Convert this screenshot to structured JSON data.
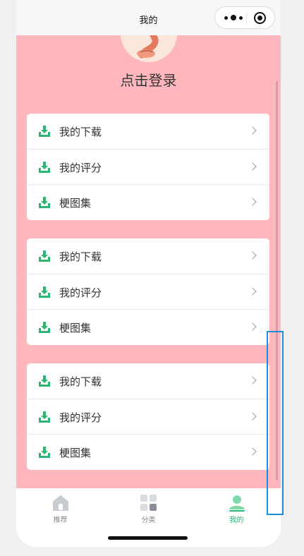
{
  "header": {
    "title": "我的"
  },
  "profile": {
    "login_text": "点击登录"
  },
  "menu_groups": [
    {
      "items": [
        {
          "label": "我的下载"
        },
        {
          "label": "我的评分"
        },
        {
          "label": "梗图集"
        }
      ]
    },
    {
      "items": [
        {
          "label": "我的下载"
        },
        {
          "label": "我的评分"
        },
        {
          "label": "梗图集"
        }
      ]
    },
    {
      "items": [
        {
          "label": "我的下载"
        },
        {
          "label": "我的评分"
        },
        {
          "label": "梗图集"
        }
      ]
    }
  ],
  "tabs": [
    {
      "label": "推荐",
      "icon": "home-icon",
      "active": false
    },
    {
      "label": "分类",
      "icon": "category-grid-icon",
      "active": false
    },
    {
      "label": "我的",
      "icon": "profile-icon",
      "active": true
    }
  ],
  "colors": {
    "page_background": "#ffb6bd",
    "accent": "#2bb673",
    "highlight_frame": "#1a8fd8"
  }
}
